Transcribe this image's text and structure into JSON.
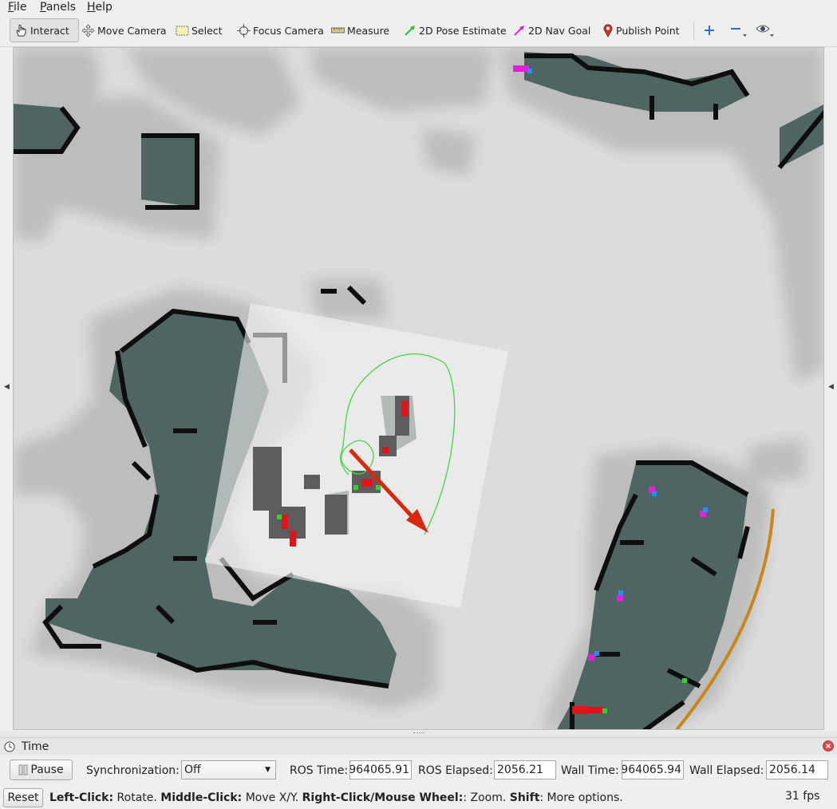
{
  "menu": [
    "File",
    "Panels",
    "Help"
  ],
  "toolbar": {
    "interact": "Interact",
    "move_camera": "Move Camera",
    "select": "Select",
    "focus_camera": "Focus Camera",
    "measure": "Measure",
    "pose_estimate": "2D Pose Estimate",
    "nav_goal": "2D Nav Goal",
    "publish_point": "Publish Point",
    "icons": [
      "hand-cursor-icon",
      "move-camera-icon",
      "select-icon",
      "focus-camera-icon",
      "ruler-icon",
      "green-arrow-icon",
      "magenta-arrow-icon",
      "map-pin-icon",
      "plus-icon",
      "minus-icon",
      "eye-icon"
    ]
  },
  "colors": {
    "free_space": "#dcdcdc",
    "inflation": "#bdbdbd",
    "obstacle": "#0e0e0e",
    "occupied_cell": "#4f6563",
    "local_costmap": "#f4f4f4",
    "pose_arrow": "#d42a10",
    "footprint": "#3fd83f",
    "global_path": "#c9861a"
  },
  "time_panel": {
    "title": "Time",
    "pause_label": "Pause",
    "sync_label": "Synchronization:",
    "sync_value": "Off",
    "ros_time_label": "ROS Time:",
    "ros_time_value": "964065.91",
    "ros_elapsed_label": "ROS Elapsed:",
    "ros_elapsed_value": "2056.21",
    "wall_time_label": "Wall Time:",
    "wall_time_value": "964065.94",
    "wall_elapsed_label": "Wall Elapsed:",
    "wall_elapsed_value": "2056.14"
  },
  "status": {
    "reset_label": "Reset",
    "left_click_key": "Left-Click:",
    "left_click_action": " Rotate. ",
    "middle_click_key": "Middle-Click:",
    "middle_click_action": " Move X/Y. ",
    "right_click_key": "Right-Click/Mouse Wheel:",
    "right_click_action": ": Zoom. ",
    "shift_key": "Shift",
    "shift_action": ": More options.",
    "fps": "31 fps"
  }
}
